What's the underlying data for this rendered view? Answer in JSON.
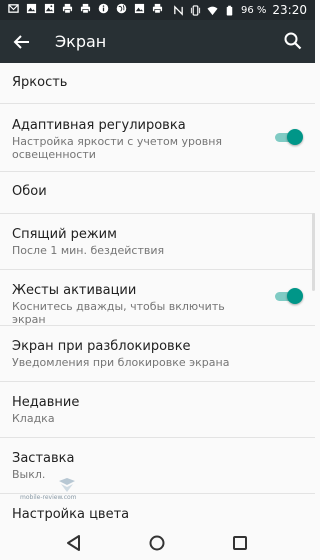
{
  "status_bar": {
    "battery_percent": "96 %",
    "time": "23:20",
    "left_icons": [
      "mail-icon",
      "image-icon",
      "gallery-icon",
      "print-icon",
      "print-icon",
      "info-icon",
      "globe-icon",
      "image-icon",
      "print-icon"
    ],
    "right_icons": [
      "nfc-icon",
      "vibrate-icon",
      "wifi-icon",
      "battery-icon"
    ]
  },
  "app_bar": {
    "title": "Экран"
  },
  "settings": [
    {
      "title": "Яркость"
    },
    {
      "title": "Адаптивная регулировка",
      "subtitle": "Настройка яркости с учетом уровня освещенности",
      "toggle": true
    },
    {
      "title": "Обои"
    },
    {
      "title": "Спящий режим",
      "subtitle": "После 1 мин. бездействия"
    },
    {
      "title": "Жесты активации",
      "subtitle": "Коснитесь дважды, чтобы включить экран",
      "toggle": true
    },
    {
      "title": "Экран при разблокировке",
      "subtitle": "Уведомления при блокировке экрана"
    },
    {
      "title": "Недавние",
      "subtitle": "Кладка"
    },
    {
      "title": "Заставка",
      "subtitle": "Выкл."
    },
    {
      "title": "Настройка цвета"
    }
  ],
  "watermark": {
    "text": "mobile-review.com"
  },
  "colors": {
    "status_bar": "#21272b",
    "app_bar": "#283034",
    "accent": "#009688",
    "track": "#80cbc4"
  }
}
